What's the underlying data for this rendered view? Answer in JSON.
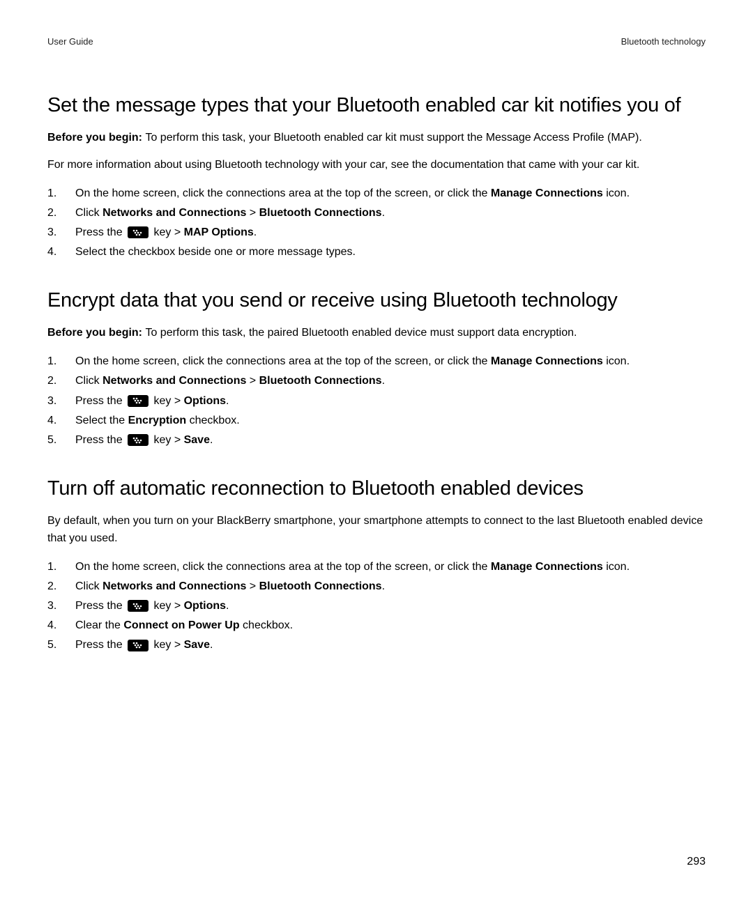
{
  "header": {
    "left": "User Guide",
    "right": "Bluetooth technology"
  },
  "pageNumber": "293",
  "sections": [
    {
      "title": "Set the message types that your Bluetooth enabled car kit notifies you of",
      "intros": [
        {
          "boldPrefix": "Before you begin: ",
          "rest": "To perform this task, your Bluetooth enabled car kit must support the Message Access Profile (MAP)."
        },
        {
          "boldPrefix": "",
          "rest": "For more information about using Bluetooth technology with your car, see the documentation that came with your car kit."
        }
      ],
      "steps": [
        {
          "parts": [
            {
              "t": "On the home screen, click the connections area at the top of the screen, or click the "
            },
            {
              "t": "Manage Connections",
              "b": true
            },
            {
              "t": " icon."
            }
          ]
        },
        {
          "parts": [
            {
              "t": "Click "
            },
            {
              "t": "Networks and Connections",
              "b": true
            },
            {
              "t": " > "
            },
            {
              "t": "Bluetooth Connections",
              "b": true
            },
            {
              "t": "."
            }
          ]
        },
        {
          "parts": [
            {
              "t": "Press the "
            },
            {
              "icon": true
            },
            {
              "t": " key > "
            },
            {
              "t": "MAP Options",
              "b": true
            },
            {
              "t": "."
            }
          ]
        },
        {
          "parts": [
            {
              "t": "Select the checkbox beside one or more message types."
            }
          ]
        }
      ]
    },
    {
      "title": "Encrypt data that you send or receive using Bluetooth technology",
      "intros": [
        {
          "boldPrefix": "Before you begin: ",
          "rest": "To perform this task, the paired Bluetooth enabled device must support data encryption."
        }
      ],
      "steps": [
        {
          "parts": [
            {
              "t": "On the home screen, click the connections area at the top of the screen, or click the "
            },
            {
              "t": "Manage Connections",
              "b": true
            },
            {
              "t": " icon."
            }
          ]
        },
        {
          "parts": [
            {
              "t": "Click "
            },
            {
              "t": "Networks and Connections",
              "b": true
            },
            {
              "t": " > "
            },
            {
              "t": "Bluetooth Connections",
              "b": true
            },
            {
              "t": "."
            }
          ]
        },
        {
          "parts": [
            {
              "t": "Press the "
            },
            {
              "icon": true
            },
            {
              "t": " key > "
            },
            {
              "t": "Options",
              "b": true
            },
            {
              "t": "."
            }
          ]
        },
        {
          "parts": [
            {
              "t": "Select the "
            },
            {
              "t": "Encryption",
              "b": true
            },
            {
              "t": " checkbox."
            }
          ]
        },
        {
          "parts": [
            {
              "t": "Press the "
            },
            {
              "icon": true
            },
            {
              "t": " key > "
            },
            {
              "t": "Save",
              "b": true
            },
            {
              "t": "."
            }
          ]
        }
      ]
    },
    {
      "title": "Turn off automatic reconnection to Bluetooth enabled devices",
      "intros": [
        {
          "boldPrefix": "",
          "rest": "By default, when you turn on your BlackBerry smartphone, your smartphone attempts to connect to the last Bluetooth enabled device that you used."
        }
      ],
      "steps": [
        {
          "parts": [
            {
              "t": "On the home screen, click the connections area at the top of the screen, or click the "
            },
            {
              "t": "Manage Connections",
              "b": true
            },
            {
              "t": " icon."
            }
          ]
        },
        {
          "parts": [
            {
              "t": "Click "
            },
            {
              "t": "Networks and Connections",
              "b": true
            },
            {
              "t": " > "
            },
            {
              "t": "Bluetooth Connections",
              "b": true
            },
            {
              "t": "."
            }
          ]
        },
        {
          "parts": [
            {
              "t": "Press the "
            },
            {
              "icon": true
            },
            {
              "t": " key > "
            },
            {
              "t": "Options",
              "b": true
            },
            {
              "t": "."
            }
          ]
        },
        {
          "parts": [
            {
              "t": "Clear the "
            },
            {
              "t": "Connect on Power Up",
              "b": true
            },
            {
              "t": " checkbox."
            }
          ]
        },
        {
          "parts": [
            {
              "t": "Press the "
            },
            {
              "icon": true
            },
            {
              "t": " key > "
            },
            {
              "t": "Save",
              "b": true
            },
            {
              "t": "."
            }
          ]
        }
      ]
    }
  ]
}
